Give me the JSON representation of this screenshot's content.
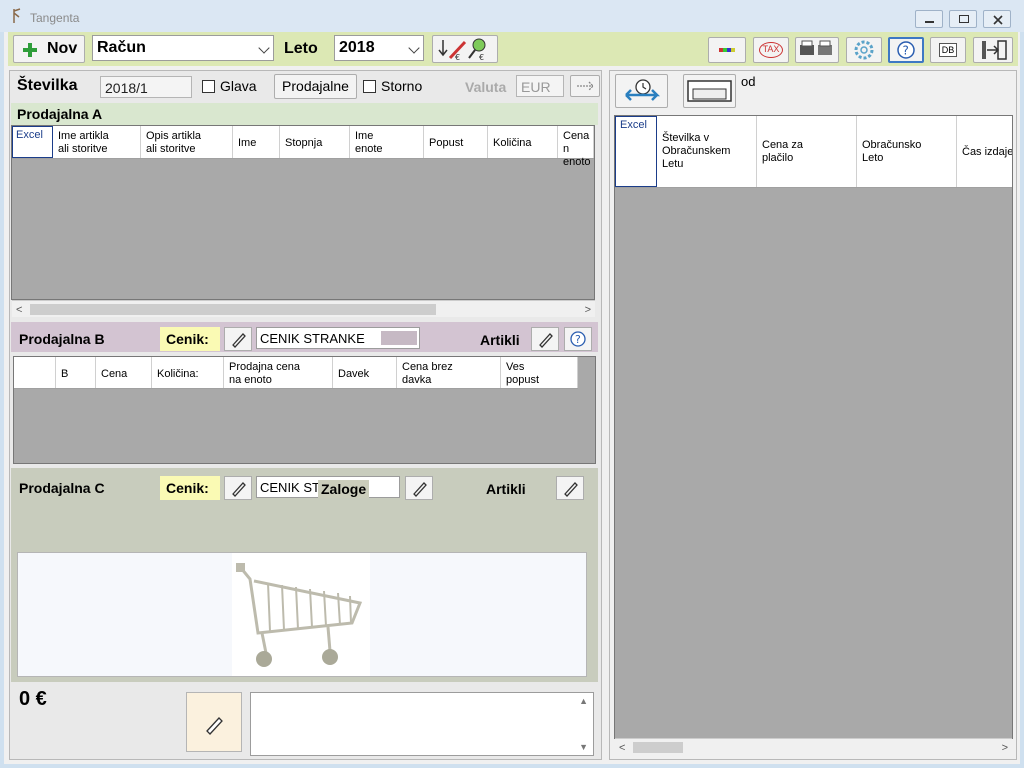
{
  "window": {
    "title": "Tangenta"
  },
  "toolbar": {
    "new_label": "Nov",
    "doc_type": "Račun",
    "year_label": "Leto",
    "year_value": "2018",
    "tax_label": "TAX",
    "db_label": "DB"
  },
  "header": {
    "number_label": "Številka",
    "number_value": "2018/1",
    "head_label": "Glava",
    "shops_button": "Prodajalne",
    "storno_label": "Storno",
    "currency_label": "Valuta",
    "currency_value": "EUR"
  },
  "shop_a": {
    "title": "Prodajalna A",
    "excel": "Excel",
    "columns": [
      [
        "Ime artikla",
        "ali storitve"
      ],
      [
        "Opis artikla",
        "ali storitve"
      ],
      [
        "Ime",
        ""
      ],
      [
        "Stopnja",
        ""
      ],
      [
        "Ime",
        "enote"
      ],
      [
        "Popust",
        ""
      ],
      [
        "Količina",
        ""
      ],
      [
        "Cena n",
        "enoto"
      ]
    ]
  },
  "shop_b": {
    "title": "Prodajalna B",
    "pricelist_label": "Cenik:",
    "pricelist_value": "CENIK STRANKE",
    "items_label": "Artikli",
    "columns": [
      [
        "",
        ""
      ],
      [
        "B",
        ""
      ],
      [
        "Cena",
        ""
      ],
      [
        "Količina:",
        ""
      ],
      [
        "Prodajna cena",
        "na enoto"
      ],
      [
        "Davek",
        ""
      ],
      [
        "Cena brez",
        "davka"
      ],
      [
        "Ves",
        "popust"
      ]
    ]
  },
  "shop_c": {
    "title": "Prodajalna C",
    "pricelist_label": "Cenik:",
    "pricelist_value": "CENIK ST",
    "stock_label": "Zaloge",
    "items_label": "Artikli"
  },
  "footer": {
    "total": "0 €"
  },
  "right": {
    "od_label": "od",
    "excel": "Excel",
    "columns": [
      [
        "Številka v",
        "Obračunskem",
        "Letu"
      ],
      [
        "Cena za",
        "plačilo",
        ""
      ],
      [
        "Obračunsko",
        "Leto",
        ""
      ],
      [
        "Čas izdaje",
        "",
        ""
      ]
    ]
  }
}
